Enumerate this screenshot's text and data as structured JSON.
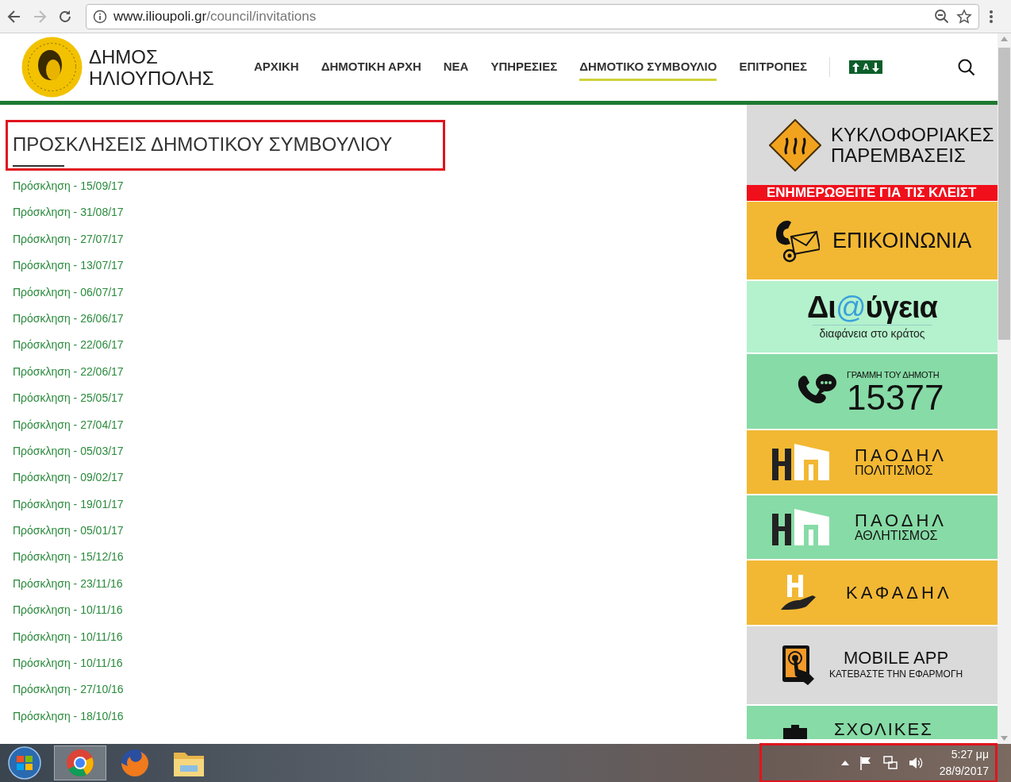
{
  "browser": {
    "url_host": "www.ilioupoli.gr",
    "url_path": "/council/invitations"
  },
  "site": {
    "logo_lines": [
      "ΔΗΜΟΣ",
      "ΗΛΙΟΥΠΟΛΗΣ"
    ],
    "nav": [
      {
        "label": "ΑΡΧΙΚΗ",
        "selected": false
      },
      {
        "label": "ΔΗΜΟΤΙΚΗ ΑΡΧΗ",
        "selected": false
      },
      {
        "label": "ΝΕΑ",
        "selected": false
      },
      {
        "label": "ΥΠΗΡΕΣΙΕΣ",
        "selected": false
      },
      {
        "label": "ΔΗΜΟΤΙΚΟ ΣΥΜΒΟΥΛΙΟ",
        "selected": true
      },
      {
        "label": "ΕΠΙΤΡΟΠΕΣ",
        "selected": false
      }
    ],
    "font_size_label": "A"
  },
  "page_title": "ΠΡΟΣΚΛΗΣΕΙΣ ΔΗΜΟΤΙΚΟΥ ΣΥΜΒΟΥΛΙΟΥ",
  "invitations": [
    "Πρόσκληση - 15/09/17",
    "Πρόσκληση - 31/08/17",
    "Πρόσκληση - 27/07/17",
    "Πρόσκληση - 13/07/17",
    "Πρόσκληση - 06/07/17",
    "Πρόσκληση - 26/06/17",
    "Πρόσκληση - 22/06/17",
    "Πρόσκληση - 22/06/17",
    "Πρόσκληση - 25/05/17",
    "Πρόσκληση - 27/04/17",
    "Πρόσκληση - 05/03/17",
    "Πρόσκληση - 09/02/17",
    "Πρόσκληση - 19/01/17",
    "Πρόσκληση - 05/01/17",
    "Πρόσκληση - 15/12/16",
    "Πρόσκληση - 23/11/16",
    "Πρόσκληση - 10/11/16",
    "Πρόσκληση - 10/11/16",
    "Πρόσκληση - 10/11/16",
    "Πρόσκληση - 27/10/16",
    "Πρόσκληση - 18/10/16"
  ],
  "sidebar": [
    {
      "kind": "traffic",
      "lines": [
        "ΚΥΚΛΟΦΟΡΙΑΚΕΣ",
        "ΠΑΡΕΜΒΑΣΕΙΣ"
      ]
    },
    {
      "kind": "ticker",
      "lines": [
        "ΕΝΗΜΕΡΩΘΕΙΤΕ ΓΙΑ ΤΙΣ ΚΛΕΙΣΤ"
      ]
    },
    {
      "kind": "contact",
      "lines": [
        "ΕΠΙΚΟΙΝΩΝΙΑ"
      ]
    },
    {
      "kind": "diavgeia",
      "lines": [
        "Δι",
        "@",
        "ύγεια",
        "διαφάνεια στο κράτος"
      ]
    },
    {
      "kind": "hotline",
      "lines": [
        "ΓΡΑΜΜΗ ΤΟΥ ΔΗΜΟΤΗ",
        "15377"
      ]
    },
    {
      "kind": "paodil_orange",
      "lines": [
        "ΠΑΟΔΗΛ",
        "ΠΟΛΙΤΙΣΜΟΣ"
      ]
    },
    {
      "kind": "paodil_green",
      "lines": [
        "ΠΑΟΔΗΛ",
        "ΑΘΛΗΤΙΣΜΟΣ"
      ]
    },
    {
      "kind": "kafadil",
      "lines": [
        "ΚΑΦΑΔΗΛ"
      ]
    },
    {
      "kind": "app",
      "lines": [
        "MOBILE APP",
        "ΚΑΤΕΒΑΣΤΕ ΤΗΝ ΕΦΑΡΜΟΓΗ"
      ]
    },
    {
      "kind": "schools",
      "lines": [
        "ΣΧΟΛΙΚΕΣ"
      ]
    }
  ],
  "taskbar": {
    "time": "5:27 μμ",
    "date": "28/9/2017"
  }
}
